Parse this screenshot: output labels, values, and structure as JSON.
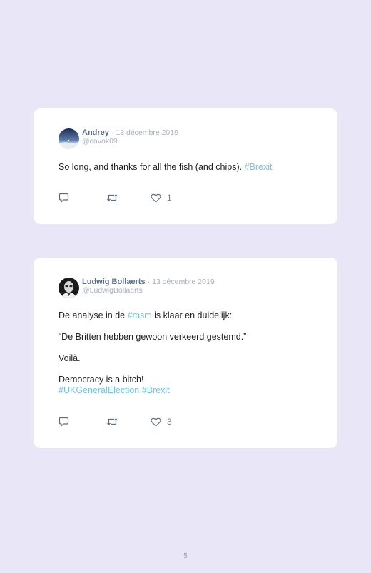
{
  "tweets": [
    {
      "name": "Andrey",
      "date": "· 13 décembre 2019",
      "handle": "@cavok09",
      "text_parts": [
        "So long, and thanks for all the fish (and chips). ",
        "#Brexit"
      ],
      "likes": "1",
      "avatar_icon": "night-sky-avatar"
    },
    {
      "name": "Ludwig Bollaerts",
      "date": "· 13 décembre 2019",
      "handle": "@LudwigBollaerts",
      "para1": [
        "De analyse in de ",
        "#msm",
        " is klaar en duidelijk:"
      ],
      "para2": "“De Britten hebben gewoon verkeerd gestemd.”",
      "para3": "Voilà.",
      "para4": "Democracy is a bitch!",
      "hashtags": [
        "#UKGeneralElection",
        "#Brexit"
      ],
      "likes": "3",
      "avatar_icon": "portrait-avatar"
    }
  ],
  "page_number": "5",
  "colors": {
    "background": "#e9e7f7",
    "card": "#ffffff",
    "name": "#5a6b86",
    "muted": "#a9afbf",
    "hashtag": "#6ec6e6",
    "icon": "#5f6b7e"
  }
}
